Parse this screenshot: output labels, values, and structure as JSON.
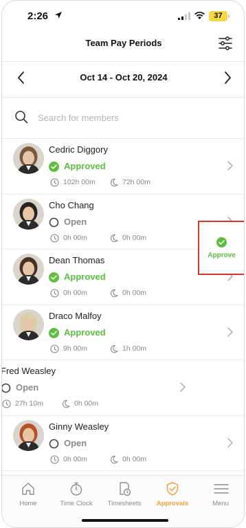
{
  "status_bar": {
    "time": "2:26",
    "battery": "37"
  },
  "header": {
    "title": "Team Pay Periods"
  },
  "period": {
    "range": "Oct 14 - Oct 20, 2024"
  },
  "search": {
    "placeholder": "Search for members"
  },
  "members": [
    {
      "name": "Cedric Diggory",
      "status": "Approved",
      "regular": "102h 00m",
      "overtime": "72h 00m",
      "avatar_color": "#7a5a3c"
    },
    {
      "name": "Cho Chang",
      "status": "Open",
      "regular": "0h 00m",
      "overtime": "0h 00m",
      "avatar_color": "#2a2320"
    },
    {
      "name": "Dean Thomas",
      "status": "Approved",
      "regular": "0h 00m",
      "overtime": "0h 00m",
      "avatar_color": "#4a3222"
    },
    {
      "name": "Draco Malfoy",
      "status": "Approved",
      "regular": "9h 00m",
      "overtime": "1h 00m",
      "avatar_color": "#d9cfa8"
    },
    {
      "name": "Fred Weasley",
      "status": "Open",
      "regular": "27h 10m",
      "overtime": "0h 00m",
      "swiped": true
    },
    {
      "name": "Ginny Weasley",
      "status": "Open",
      "regular": "0h 00m",
      "overtime": "0h 00m",
      "avatar_color": "#b8502a"
    }
  ],
  "swipe_action": {
    "label": "Approve"
  },
  "tabs": [
    {
      "label": "Home",
      "icon": "home-icon"
    },
    {
      "label": "Time Clock",
      "icon": "stopwatch-icon"
    },
    {
      "label": "Timesheets",
      "icon": "timesheet-icon"
    },
    {
      "label": "Approvals",
      "icon": "shield-check-icon",
      "active": true
    },
    {
      "label": "Menu",
      "icon": "hamburger-icon"
    }
  ],
  "colors": {
    "approved": "#5cbf3f",
    "active_tab": "#f0a23b",
    "highlight": "#d8322f"
  }
}
